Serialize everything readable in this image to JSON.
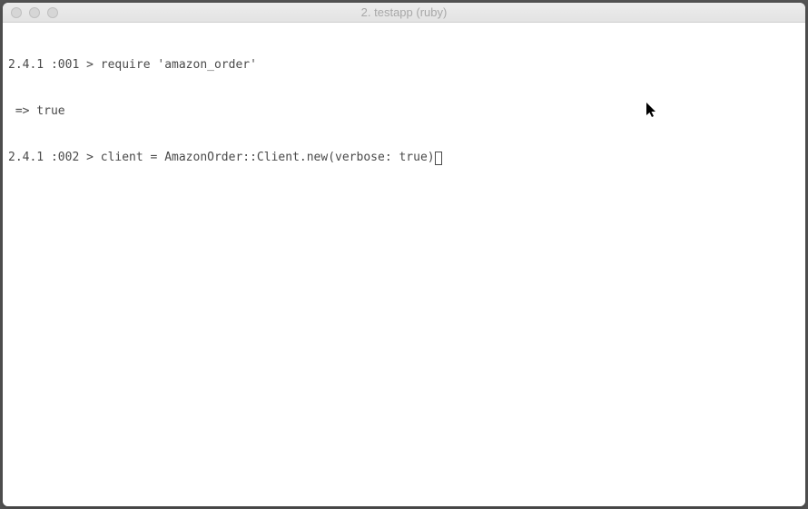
{
  "window": {
    "title": "2. testapp (ruby)"
  },
  "terminal": {
    "line1_prompt": "2.4.1 :001 > ",
    "line1_cmd": "require 'amazon_order'",
    "line2": " => true ",
    "line3_prompt": "2.4.1 :002 > ",
    "line3_cmd": "client = AmazonOrder::Client.new(verbose: true)"
  }
}
